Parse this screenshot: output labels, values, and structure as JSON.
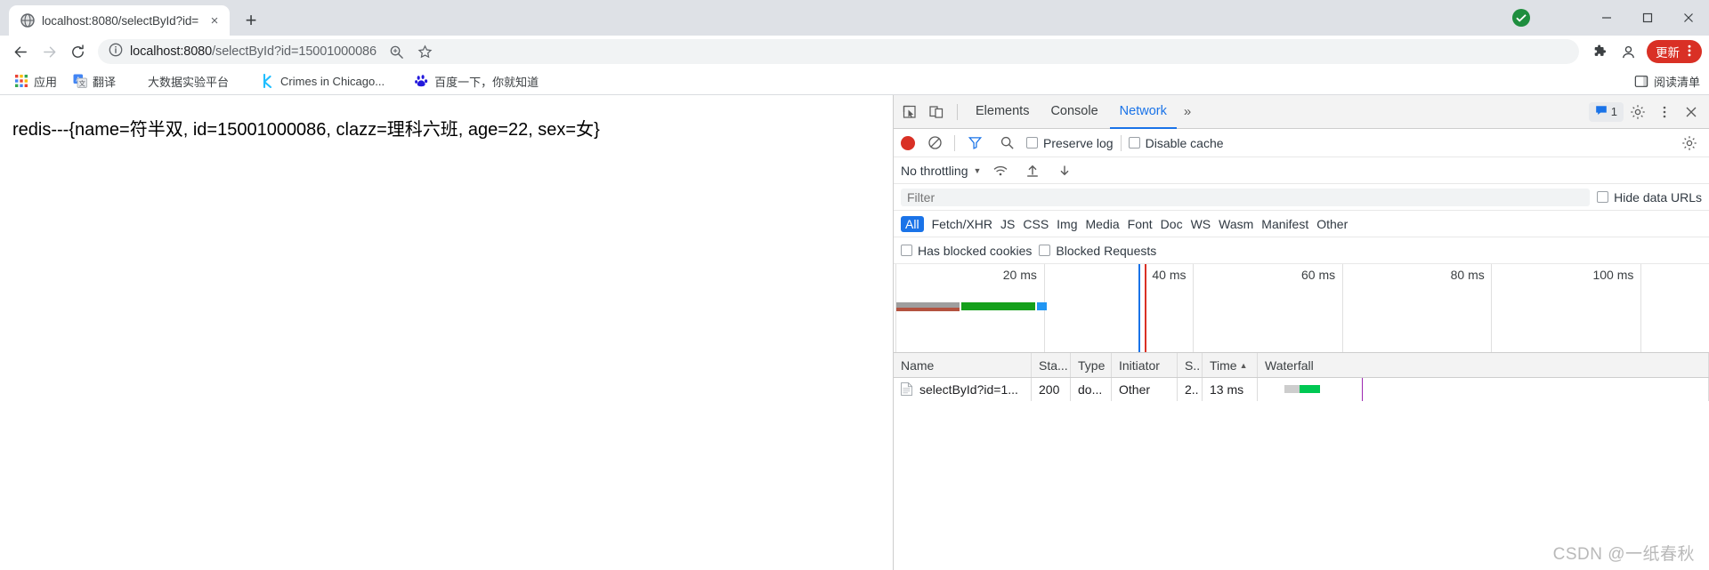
{
  "window": {
    "tab": {
      "title": "localhost:8080/selectById?id=",
      "favicon": "globe-icon",
      "close": "×"
    },
    "new_tab_label": "+",
    "controls": {
      "minimize": "minimize-icon",
      "maximize": "maximize-icon",
      "close": "close-icon"
    }
  },
  "toolbar": {
    "back": "back-arrow-icon",
    "forward": "forward-arrow-icon",
    "reload": "reload-icon",
    "site_info": "info-circle-icon",
    "url_host": "localhost:8080",
    "url_path": "/selectById?id=15001000086",
    "url_full": "localhost:8080/selectById?id=15001000086",
    "zoom_icon": "zoom-magnifier-icon",
    "bookmark_icon": "star-icon",
    "extensions_icon": "puzzle-piece-icon",
    "profile_icon": "person-icon",
    "update_label": "更新",
    "update_color": "#d93025",
    "menu_icon": "three-dots-vertical-icon"
  },
  "bookmarks": {
    "items": [
      {
        "label": "应用",
        "icon": "apps-grid-icon"
      },
      {
        "label": "翻译",
        "icon": "google-translate-icon"
      },
      {
        "label": "大数据实验平台",
        "icon": "blank-icon"
      },
      {
        "label": "Crimes in Chicago...",
        "icon": "kaggle-icon"
      },
      {
        "label": "百度一下，你就知道",
        "icon": "baidu-paw-icon"
      }
    ],
    "reading_list": {
      "label": "阅读清单",
      "icon": "reading-list-icon"
    },
    "bookmark_manager_icon": "bookmark-panel-icon"
  },
  "page": {
    "text": "redis---{name=符半双, id=15001000086, clazz=理科六班, age=22, sex=女}"
  },
  "devtools": {
    "inspect_icon": "inspect-cursor-icon",
    "device_icon": "device-toolbar-icon",
    "tabs": [
      {
        "label": "Elements",
        "active": false
      },
      {
        "label": "Console",
        "active": false
      },
      {
        "label": "Network",
        "active": true
      }
    ],
    "more_tabs_icon": "chevron-double-right-icon",
    "messages_count": "1",
    "messages_icon": "speech-bubble-icon",
    "settings_icon": "gear-icon",
    "kebab_icon": "three-dots-vertical-icon",
    "close_icon": "close-icon",
    "network": {
      "record_icon": "record-circle-icon",
      "clear_icon": "clear-no-entry-icon",
      "filter_icon": "funnel-icon",
      "search_icon": "search-magnifier-icon",
      "preserve_log_label": "Preserve log",
      "disable_cache_label": "Disable cache",
      "network_settings_icon": "gear-icon",
      "throttling_label": "No throttling",
      "throttling_caret": "▼",
      "wifi_icon": "wifi-icon",
      "import_icon": "upload-arrow-icon",
      "export_icon": "download-arrow-icon",
      "filter_placeholder": "Filter",
      "hide_data_urls_label": "Hide data URLs",
      "type_filters": [
        {
          "label": "All",
          "active": true
        },
        {
          "label": "Fetch/XHR",
          "active": false
        },
        {
          "label": "JS",
          "active": false
        },
        {
          "label": "CSS",
          "active": false
        },
        {
          "label": "Img",
          "active": false
        },
        {
          "label": "Media",
          "active": false
        },
        {
          "label": "Font",
          "active": false
        },
        {
          "label": "Doc",
          "active": false
        },
        {
          "label": "WS",
          "active": false
        },
        {
          "label": "Wasm",
          "active": false
        },
        {
          "label": "Manifest",
          "active": false
        },
        {
          "label": "Other",
          "active": false
        }
      ],
      "has_blocked_cookies_label": "Has blocked cookies",
      "blocked_requests_label": "Blocked Requests",
      "overview": {
        "ticks": [
          "20 ms",
          "40 ms",
          "60 ms",
          "80 ms",
          "100 ms"
        ],
        "bars": [
          {
            "color": "#9e9e9e",
            "left_pct": 0.5,
            "width_pct": 7.5
          },
          {
            "color": "#4caf50",
            "left_pct": 8.4,
            "width_pct": 8.9
          },
          {
            "color": "#2196f3",
            "left_pct": 17.5,
            "width_pct": 1.4
          },
          {
            "color": "#b3523f",
            "left_pct": 0.5,
            "width_pct": 7.5
          }
        ],
        "markers": [
          {
            "color": "#1a73e8",
            "left_pct": 30.2
          },
          {
            "color": "#d93025",
            "left_pct": 30.9
          }
        ]
      },
      "table": {
        "columns": [
          "Name",
          "Sta...",
          "Type",
          "Initiator",
          "S..",
          "Time",
          "Waterfall"
        ],
        "sorted_column": "Time",
        "sort_arrow": "▲",
        "rows": [
          {
            "icon": "document-icon",
            "name": "selectById?id=1...",
            "status": "200",
            "type": "do...",
            "initiator": "Other",
            "size": "2..",
            "time": "13 ms",
            "waterfall": {
              "bar_left_pct": 8.0,
              "bar_width_pct": 5.0,
              "bar_color": "#00c853",
              "bar_pre_color": "#cdcdcd",
              "line_left_pct": 22.5,
              "line_color": "#9c27b0"
            }
          }
        ]
      }
    }
  },
  "watermark": "CSDN @一纸春秋"
}
